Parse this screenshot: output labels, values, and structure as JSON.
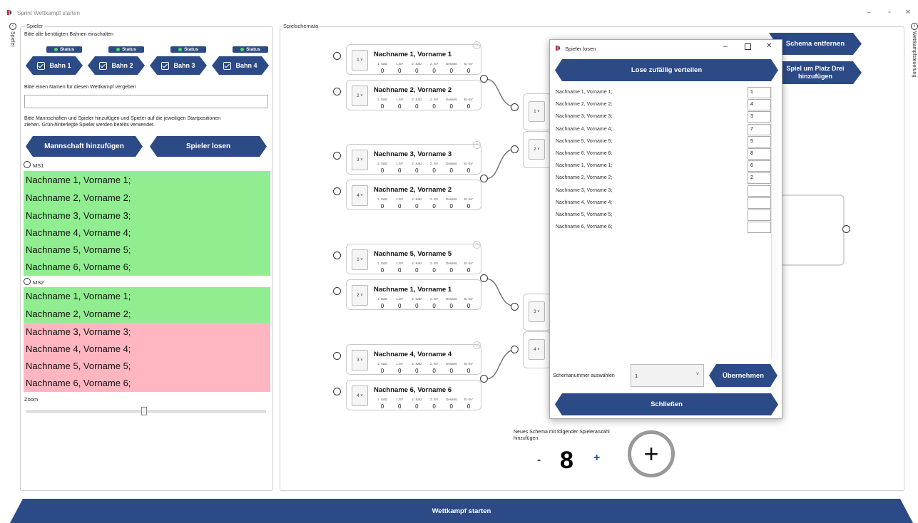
{
  "window": {
    "title": "Sprint Wettkampf starten",
    "minimize": "–",
    "maximize": "▫",
    "close": "✕"
  },
  "side_tabs": {
    "left": "Spieler",
    "right": "Wettkampfsteuerung"
  },
  "left_panel": {
    "group_title": "Spieler",
    "bahnen_hint": "Bitte alle benötigten Bahnen einschalten",
    "bahnen": [
      {
        "status": "Status",
        "label": "Bahn 1"
      },
      {
        "status": "Status",
        "label": "Bahn 2"
      },
      {
        "status": "Status",
        "label": "Bahn 3"
      },
      {
        "status": "Status",
        "label": "Bahn 4"
      }
    ],
    "name_hint": "Bitte einen Namen für diesen Wettkampf vergeben",
    "name_value": "",
    "teams_hint_1": "Bitte Mannschaften und Spieler hinzufügen und Spieler auf die jeweiligen Startpositionen",
    "teams_hint_2": "ziehen. Grün-hinterlegte Spieler werden bereits verwendet.",
    "add_team_button": "Mannschaft hinzufügen",
    "draw_button": "Spieler losen",
    "teams": [
      {
        "name": "MS1",
        "players": [
          "Nachname 1, Vorname 1;",
          "Nachname 2, Vorname 2;",
          "Nachname 3, Vorname 3;",
          "Nachname 4, Vorname 4;",
          "Nachname 5, Vorname 5;",
          "Nachname 6, Vorname 6;"
        ]
      },
      {
        "name": "MS2",
        "players": [
          "Nachname 1, Vorname 1;",
          "Nachname 2, Vorname 2;",
          "Nachname 3, Vorname 3;",
          "Nachname 4, Vorname 4;",
          "Nachname 5, Vorname 5;",
          "Nachname 6, Vorname 6;"
        ]
      }
    ],
    "zoom_label": "Zoom",
    "zoom_level": 0.5
  },
  "schema_panel": {
    "group_title": "Spielschemata",
    "remove_button": "Schema entfernen",
    "third_place_button_1": "Spiel um Platz Drei",
    "third_place_button_2": "hinzufügen",
    "score_headers": [
      "1. Satz",
      "1.SV",
      "2. Satz",
      "2. SV",
      "Gesamt",
      "B.-SV"
    ],
    "matches": [
      {
        "seed": "1",
        "name": "Nachname 1, Vorname 1",
        "scores": [
          "0",
          "0",
          "0",
          "0",
          "0",
          "0"
        ]
      },
      {
        "seed": "2",
        "name": "Nachname 2, Vorname 2",
        "scores": [
          "0",
          "0",
          "0",
          "0",
          "0",
          "0"
        ]
      },
      {
        "seed": "3",
        "name": "Nachname 3, Vorname 3",
        "scores": [
          "0",
          "0",
          "0",
          "0",
          "0",
          "0"
        ]
      },
      {
        "seed": "4",
        "name": "Nachname 2, Vorname 2",
        "scores": [
          "0",
          "0",
          "0",
          "0",
          "0",
          "0"
        ]
      },
      {
        "seed": "1",
        "name": "Nachname 5, Vorname 5",
        "scores": [
          "0",
          "0",
          "0",
          "0",
          "0",
          "0"
        ]
      },
      {
        "seed": "2",
        "name": "Nachname 1, Vorname 1",
        "scores": [
          "0",
          "0",
          "0",
          "0",
          "0",
          "0"
        ]
      },
      {
        "seed": "3",
        "name": "Nachname 4, Vorname 4",
        "scores": [
          "0",
          "0",
          "0",
          "0",
          "0",
          "0"
        ]
      },
      {
        "seed": "4",
        "name": "Nachname 6, Vorname 6",
        "scores": [
          "0",
          "0",
          "0",
          "0",
          "0",
          "0"
        ]
      }
    ],
    "round2_seeds": [
      "1",
      "2",
      "3",
      "4"
    ],
    "new_schema_label_1": "Neues Schema mit folgender Spieleranzahl",
    "new_schema_label_2": "hinzufügen",
    "player_count": "8",
    "minus": "-",
    "plus": "+",
    "add_symbol": "+"
  },
  "dialog": {
    "title": "Spieler losen",
    "random_button": "Lose zufällig verteilen",
    "entries": [
      {
        "name": "Nachname 1, Vorname 1;",
        "value": "1"
      },
      {
        "name": "Nachname 2, Vorname 2;",
        "value": "4"
      },
      {
        "name": "Nachname 3, Vorname 3;",
        "value": "3"
      },
      {
        "name": "Nachname 4, Vorname 4;",
        "value": "7"
      },
      {
        "name": "Nachname 5, Vorname 5;",
        "value": "5"
      },
      {
        "name": "Nachname 6, Vorname 6;",
        "value": "8"
      },
      {
        "name": "Nachname 1, Vorname 1;",
        "value": "6"
      },
      {
        "name": "Nachname 2, Vorname 2;",
        "value": "2"
      },
      {
        "name": "Nachname 3, Vorname 3;",
        "value": ""
      },
      {
        "name": "Nachname 4, Vorname 4;",
        "value": ""
      },
      {
        "name": "Nachname 5, Vorname 5;",
        "value": ""
      },
      {
        "name": "Nachname 6, Vorname 6;",
        "value": ""
      }
    ],
    "schema_label": "Schemanummer auswählen",
    "schema_value": "1",
    "apply_button": "Übernehmen",
    "close_button": "Schließen"
  },
  "footer": {
    "start_button": "Wettkampf starten"
  },
  "colors": {
    "accent": "#2c4a86",
    "used_player": "#90ee90",
    "unused_player": "#ffb6c1",
    "status_dot": "#4cd964"
  }
}
